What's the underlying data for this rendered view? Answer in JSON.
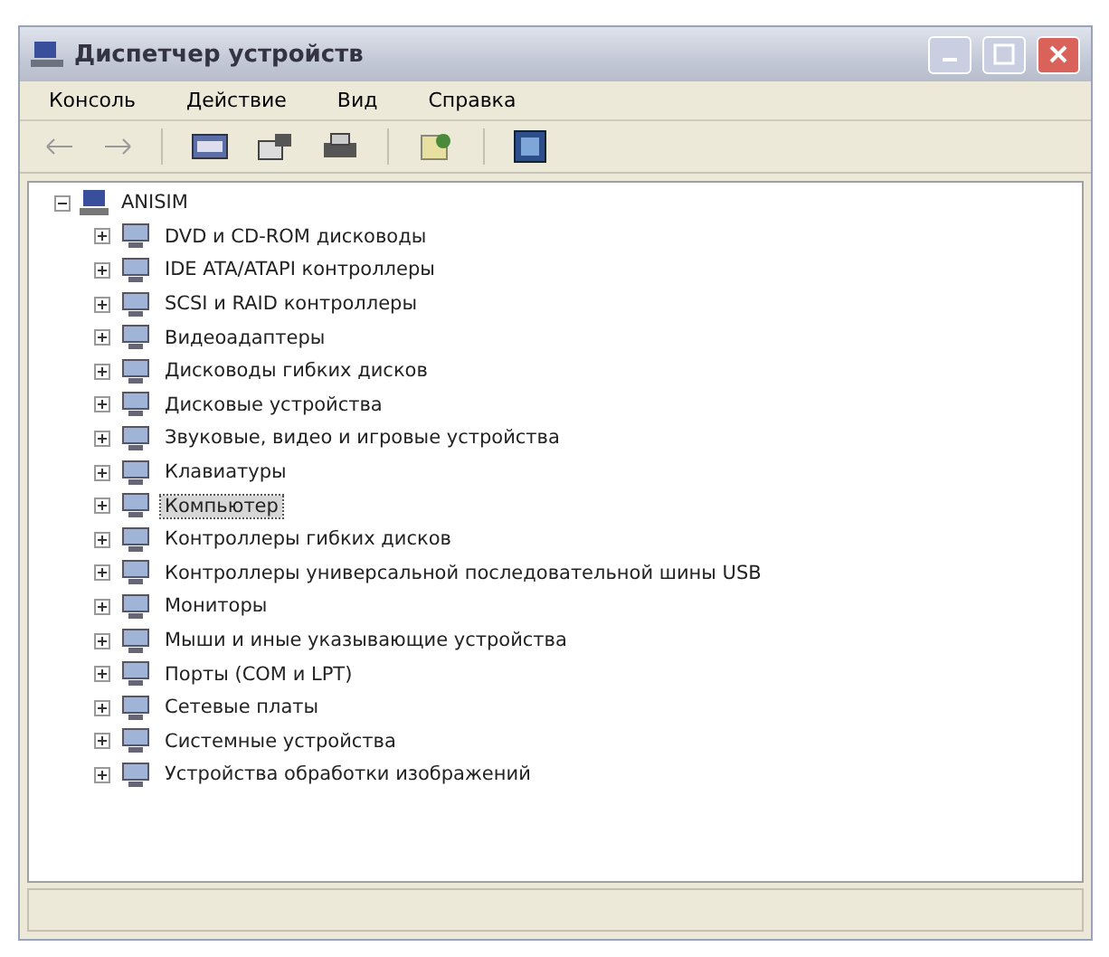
{
  "window": {
    "title": "Диспетчер устройств"
  },
  "menu": [
    {
      "label": "Консоль"
    },
    {
      "label": "Действие"
    },
    {
      "label": "Вид"
    },
    {
      "label": "Справка"
    }
  ],
  "tree": {
    "label": "ANISIM",
    "expanded": true,
    "children": [
      {
        "label": "DVD и CD-ROM дисководы",
        "expanded": false,
        "selected": false
      },
      {
        "label": "IDE ATA/ATAPI контроллеры",
        "expanded": false,
        "selected": false
      },
      {
        "label": "SCSI и RAID контроллеры",
        "expanded": false,
        "selected": false
      },
      {
        "label": "Видеоадаптеры",
        "expanded": false,
        "selected": false
      },
      {
        "label": "Дисководы гибких дисков",
        "expanded": false,
        "selected": false
      },
      {
        "label": "Дисковые устройства",
        "expanded": false,
        "selected": false
      },
      {
        "label": "Звуковые, видео и игровые устройства",
        "expanded": false,
        "selected": false
      },
      {
        "label": "Клавиатуры",
        "expanded": false,
        "selected": false
      },
      {
        "label": "Компьютер",
        "expanded": false,
        "selected": true
      },
      {
        "label": "Контроллеры гибких дисков",
        "expanded": false,
        "selected": false
      },
      {
        "label": "Контроллеры универсальной последовательной шины USB",
        "expanded": false,
        "selected": false
      },
      {
        "label": "Мониторы",
        "expanded": false,
        "selected": false
      },
      {
        "label": "Мыши и иные указывающие устройства",
        "expanded": false,
        "selected": false
      },
      {
        "label": "Порты (COM и LPT)",
        "expanded": false,
        "selected": false
      },
      {
        "label": "Сетевые платы",
        "expanded": false,
        "selected": false
      },
      {
        "label": "Системные устройства",
        "expanded": false,
        "selected": false
      },
      {
        "label": "Устройства обработки изображений",
        "expanded": false,
        "selected": false
      }
    ]
  }
}
